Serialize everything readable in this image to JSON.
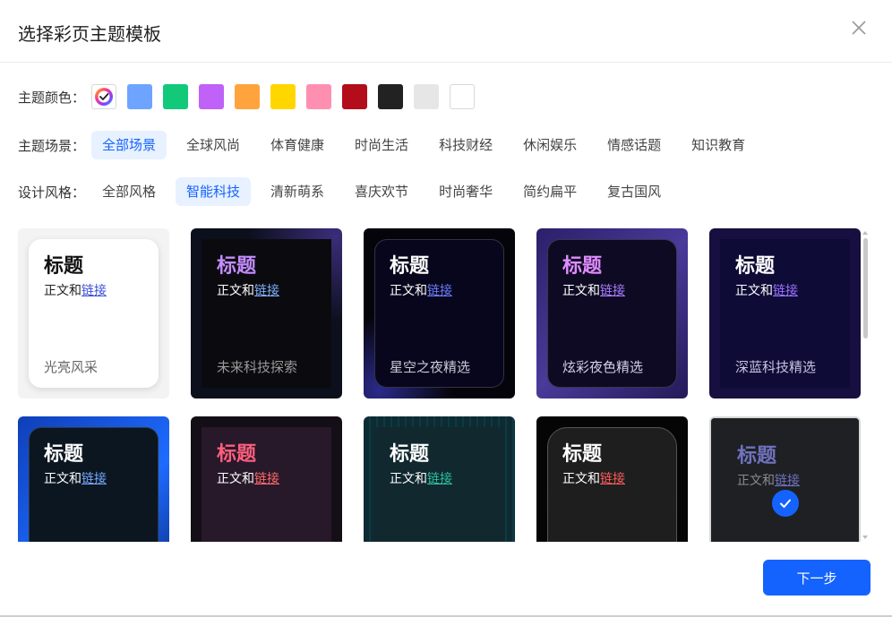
{
  "dialog": {
    "title": "选择彩页主题模板",
    "next_label": "下一步"
  },
  "colors": {
    "label": "主题颜色：",
    "swatches": [
      "#6ea4ff",
      "#12c97a",
      "#c061f7",
      "#ffa43c",
      "#ffd600",
      "#ff8fb1",
      "#b30c1a",
      "#222222",
      "#e6e6e6",
      "#ffffff"
    ]
  },
  "scenes": {
    "label": "主题场景：",
    "items": [
      "全部场景",
      "全球风尚",
      "体育健康",
      "时尚生活",
      "科技财经",
      "休闲娱乐",
      "情感话题",
      "知识教育"
    ],
    "active": 0
  },
  "styles": {
    "label": "设计风格：",
    "items": [
      "全部风格",
      "智能科技",
      "清新萌系",
      "喜庆欢节",
      "时尚奢华",
      "简约扁平",
      "复古国风"
    ],
    "active": 1
  },
  "card_common": {
    "title": "标题",
    "body": "正文和",
    "link": "链接"
  },
  "templates": [
    {
      "caption": "光亮风采",
      "bg": "#f3f3f3",
      "inner": "#ffffff",
      "title_color": "#111111",
      "body_color": "#222222",
      "link_color": "#3b4fd8",
      "caption_color": "#666666"
    },
    {
      "caption": "未来科技探索",
      "bg": "#0c0f1c",
      "inner": "#0b0b0f",
      "title_color": "#c58cff",
      "body_color": "#ffffff",
      "link_color": "#7fb1ff",
      "caption_color": "#9a9a9a"
    },
    {
      "caption": "星空之夜精选",
      "bg": "#05040a",
      "inner": "#07061d",
      "title_color": "#ffffff",
      "body_color": "#ffffff",
      "link_color": "#6c7dff",
      "caption_color": "#c9c9d6"
    },
    {
      "caption": "炫彩夜色精选",
      "bg": "#3a2a7c",
      "inner": "#0f0a24",
      "title_color": "#e08cff",
      "body_color": "#ffffff",
      "link_color": "#a87dff",
      "caption_color": "#d5cfe6"
    },
    {
      "caption": "深蓝科技精选",
      "bg": "#160f3f",
      "inner": "#0e0b36",
      "title_color": "#ffffff",
      "body_color": "#ffffff",
      "link_color": "#9a73ff",
      "caption_color": "#c8c3e0"
    },
    {
      "caption": "",
      "bg": "#1349c8",
      "inner": "#0b1620",
      "title_color": "#ffffff",
      "body_color": "#ffffff",
      "link_color": "#74a8ff",
      "caption_color": "#cccccc"
    },
    {
      "caption": "",
      "bg": "#140e16",
      "inner": "#27182a",
      "title_color": "#ff5f7d",
      "body_color": "#ffffff",
      "link_color": "#ff6b6b",
      "caption_color": "#cccccc"
    },
    {
      "caption": "",
      "bg": "#0d2b33",
      "inner": "#11282f",
      "title_color": "#ffffff",
      "body_color": "#ffffff",
      "link_color": "#2ac3a0",
      "caption_color": "#cccccc"
    },
    {
      "caption": "",
      "bg": "#050505",
      "inner": "#1e1e1e",
      "title_color": "#ffffff",
      "body_color": "#ffffff",
      "link_color": "#ff5a5a",
      "caption_color": "#cccccc"
    },
    {
      "caption": "",
      "bg": "#1f2024",
      "inner": "#1f2024",
      "title_color": "#6f73bf",
      "body_color": "#8a8c95",
      "link_color": "#6f73bf",
      "caption_color": "#cccccc"
    }
  ],
  "selected_template": 9,
  "colors_accent": "#1463ff"
}
